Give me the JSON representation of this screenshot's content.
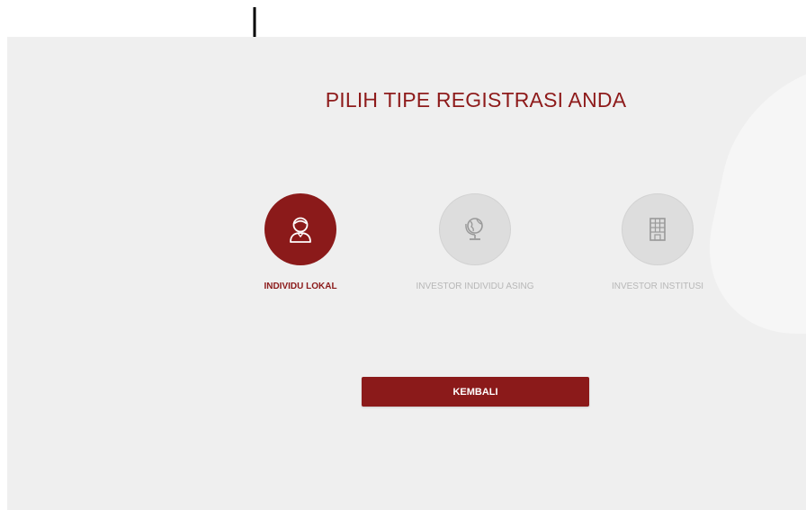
{
  "page": {
    "title": "PILIH TIPE REGISTRASI ANDA"
  },
  "registration_types": [
    {
      "label": "INDIVIDU LOKAL",
      "icon": "person-icon",
      "selected": true
    },
    {
      "label": "INVESTOR INDIVIDU ASING",
      "icon": "globe-icon",
      "selected": false
    },
    {
      "label": "INVESTOR INSTITUSI",
      "icon": "building-icon",
      "selected": false
    }
  ],
  "actions": {
    "back_label": "KEMBALI"
  },
  "colors": {
    "accent": "#8b1a1a",
    "inactive_circle": "#dddddd",
    "inactive_text": "#b7b7b7",
    "panel_background": "#efefef"
  }
}
